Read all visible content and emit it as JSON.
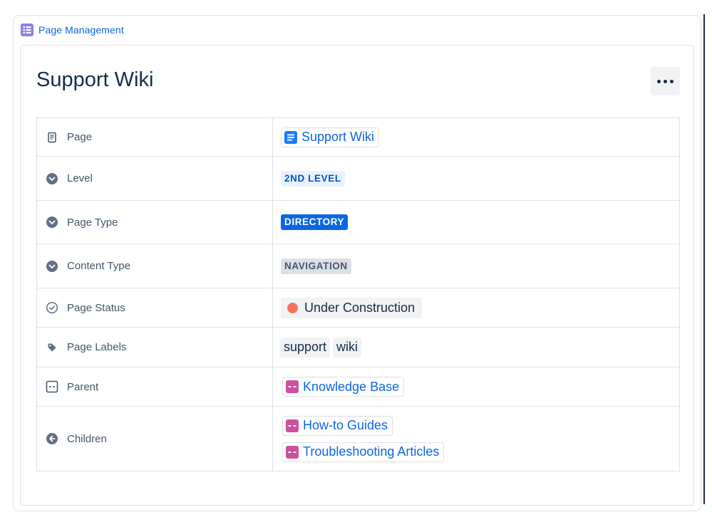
{
  "macro": {
    "title": "Page Management",
    "icon": "table-icon"
  },
  "card": {
    "title": "Support Wiki",
    "more_icon": "more-horizontal-icon"
  },
  "rows": {
    "page": {
      "label": "Page",
      "icon": "page-icon",
      "value": "Support Wiki",
      "value_icon": "page-doc-icon"
    },
    "level": {
      "label": "Level",
      "icon": "chevron-down-circle-icon",
      "value": "2ND LEVEL"
    },
    "page_type": {
      "label": "Page Type",
      "icon": "chevron-down-circle-icon",
      "value": "DIRECTORY"
    },
    "content_type": {
      "label": "Content Type",
      "icon": "chevron-down-circle-icon",
      "value": "NAVIGATION"
    },
    "page_status": {
      "label": "Page Status",
      "icon": "check-circle-icon",
      "value": "Under Construction",
      "dot_color": "#f87462"
    },
    "page_labels": {
      "label": "Page Labels",
      "icon": "tag-icon",
      "values": [
        "support",
        "wiki"
      ]
    },
    "parent": {
      "label": "Parent",
      "icon": "folder-outline-icon",
      "value": "Knowledge Base",
      "value_icon": "folder-icon"
    },
    "children": {
      "label": "Children",
      "icon": "arrow-left-circle-icon",
      "values": [
        "How-to Guides",
        "Troubleshooting Articles"
      ],
      "value_icon": "folder-icon"
    }
  },
  "colors": {
    "link": "#0c66e4",
    "folder": "#cd519d",
    "page_icon": "#1d7afc",
    "macro_icon": "#8f7ee7"
  }
}
